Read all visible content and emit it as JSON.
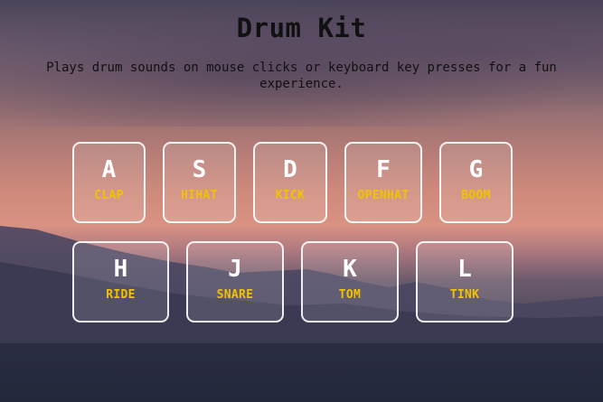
{
  "header": {
    "title": "Drum Kit",
    "subtitle": "Plays drum sounds on mouse clicks or keyboard key presses for a fun experience."
  },
  "keys": [
    {
      "letter": "A",
      "sound": "CLAP"
    },
    {
      "letter": "S",
      "sound": "HIHAT"
    },
    {
      "letter": "D",
      "sound": "KICK"
    },
    {
      "letter": "F",
      "sound": "OPENHAT"
    },
    {
      "letter": "G",
      "sound": "BOOM"
    },
    {
      "letter": "H",
      "sound": "RIDE"
    },
    {
      "letter": "J",
      "sound": "SNARE"
    },
    {
      "letter": "K",
      "sound": "TOM"
    },
    {
      "letter": "L",
      "sound": "TINK"
    }
  ],
  "colors": {
    "title_text": "#111111",
    "key_letter": "#ffffff",
    "key_sound": "#f2c200",
    "key_border": "#ffffff"
  }
}
